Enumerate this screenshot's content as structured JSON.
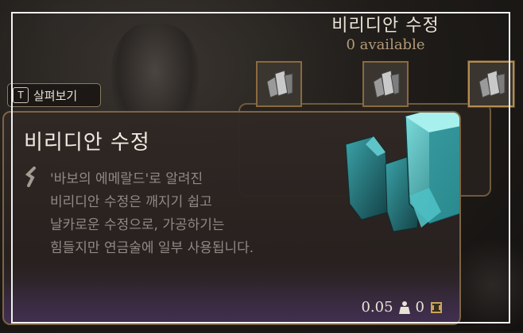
{
  "header": {
    "title": "비리디안 수정",
    "available": "0 available"
  },
  "inspect_prompt": {
    "key": "T",
    "label": "살펴보기"
  },
  "slots": [
    {
      "icon": "crystal-icon",
      "selected": false
    },
    {
      "icon": "crystal-icon",
      "selected": false
    },
    {
      "icon": "crystal-icon",
      "selected": true
    }
  ],
  "tooltip": {
    "title": "비리디안 수정",
    "description_lines": [
      "'바보의 에메랄드'로 알려진",
      "비리디안 수정은 깨지기 쉽고",
      "날카로운 수정으로, 가공하기는",
      "힘들지만 연금술에 일부 사용됩니다."
    ],
    "weight": "0.05",
    "value": "0",
    "weight_icon": "weight-icon",
    "value_icon": "coin-icon"
  },
  "colors": {
    "accent_gold": "#b58c50",
    "crystal_teal": "#3fb3b5",
    "title_text": "#f0ebe1",
    "description_text": "#8f8a84"
  }
}
